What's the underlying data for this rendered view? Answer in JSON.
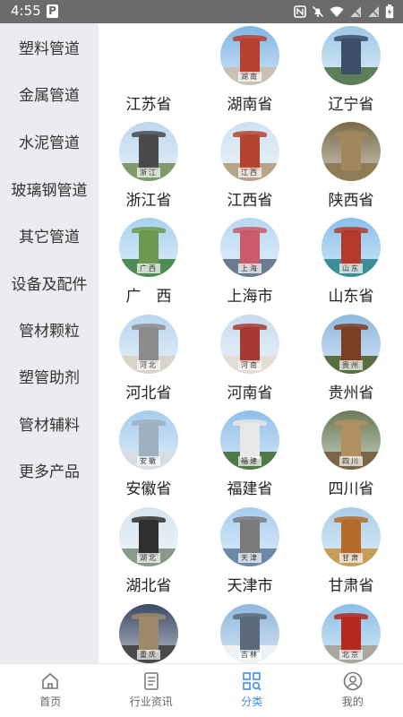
{
  "status_bar": {
    "time": "4:55",
    "icons": [
      "p-icon",
      "nfc-icon",
      "mute-icon",
      "wifi-icon",
      "signal-icon",
      "signal-icon",
      "battery-icon"
    ]
  },
  "sidebar": {
    "items": [
      {
        "label": "塑料管道"
      },
      {
        "label": "金属管道"
      },
      {
        "label": "水泥管道"
      },
      {
        "label": "玻璃钢管道"
      },
      {
        "label": "其它管道"
      },
      {
        "label": "设备及配件"
      },
      {
        "label": "管材颗粒"
      },
      {
        "label": "塑管助剂"
      },
      {
        "label": "管材辅料"
      },
      {
        "label": "更多产品"
      }
    ]
  },
  "provinces": [
    {
      "label": "江苏省",
      "tag": "",
      "image": false,
      "sky": "#ffffff",
      "ground": "#ffffff",
      "building": "#ffffff"
    },
    {
      "label": "湖南省",
      "tag": "湖南",
      "image": true,
      "sky": "#7fb6e6",
      "ground": "#c9c2b4",
      "building": "#b8402f"
    },
    {
      "label": "辽宁省",
      "tag": "",
      "image": true,
      "sky": "#9ec8e8",
      "ground": "#5e7d5a",
      "building": "#3c4f66"
    },
    {
      "label": "浙江省",
      "tag": "浙江",
      "image": true,
      "sky": "#bcd7ee",
      "ground": "#7f9a6a",
      "building": "#4a4a4a"
    },
    {
      "label": "江西省",
      "tag": "江西",
      "image": true,
      "sky": "#cfe2f2",
      "ground": "#b6a48a",
      "building": "#b5442e"
    },
    {
      "label": "陕西省",
      "tag": "",
      "image": true,
      "sky": "#7a6a4a",
      "ground": "#8f7b55",
      "building": "#a08a5c"
    },
    {
      "label": "广　西",
      "tag": "广西",
      "image": true,
      "sky": "#a8d1ee",
      "ground": "#4f8b57",
      "building": "#6b9a4e"
    },
    {
      "label": "上海市",
      "tag": "上海",
      "image": true,
      "sky": "#b7d7f3",
      "ground": "#6b7c90",
      "building": "#c95a6a"
    },
    {
      "label": "山东省",
      "tag": "山东",
      "image": true,
      "sky": "#86c0ea",
      "ground": "#3d8f97",
      "building": "#b33a2b"
    },
    {
      "label": "河北省",
      "tag": "河北",
      "image": true,
      "sky": "#b9d6ee",
      "ground": "#d9d4c9",
      "building": "#8c8c8c"
    },
    {
      "label": "河南省",
      "tag": "河南",
      "image": true,
      "sky": "#c7dcef",
      "ground": "#e4ddd3",
      "building": "#a63a33"
    },
    {
      "label": "贵州省",
      "tag": "贵州",
      "image": true,
      "sky": "#8db8df",
      "ground": "#58703f",
      "building": "#7a3e22"
    },
    {
      "label": "安徽省",
      "tag": "安徽",
      "image": true,
      "sky": "#a6cdee",
      "ground": "#d8dde3",
      "building": "#9fb0c0"
    },
    {
      "label": "福建省",
      "tag": "福建",
      "image": true,
      "sky": "#8fbfe9",
      "ground": "#4f7a45",
      "building": "#e8e8e8"
    },
    {
      "label": "四川省",
      "tag": "四川",
      "image": true,
      "sky": "#6a7a55",
      "ground": "#7c6548",
      "building": "#b08f63"
    },
    {
      "label": "湖北省",
      "tag": "湖北",
      "image": true,
      "sky": "#d6e4ef",
      "ground": "#8a9a8a",
      "building": "#2f2f2f"
    },
    {
      "label": "天津市",
      "tag": "天津",
      "image": true,
      "sky": "#a8cdef",
      "ground": "#6c8aa8",
      "building": "#7a7a7a"
    },
    {
      "label": "甘肃省",
      "tag": "甘肃",
      "image": true,
      "sky": "#a9cdea",
      "ground": "#c79d5a",
      "building": "#b46a2a"
    },
    {
      "label": "",
      "tag": "重庆",
      "image": true,
      "sky": "#3b4a66",
      "ground": "#4a4a4a",
      "building": "#9c8a6a"
    },
    {
      "label": "",
      "tag": "吉林",
      "image": true,
      "sky": "#8fb8dd",
      "ground": "#eef2f5",
      "building": "#5b6b7b"
    },
    {
      "label": "",
      "tag": "北京",
      "image": true,
      "sky": "#8cbfe8",
      "ground": "#a8a8a0",
      "building": "#b3281f"
    }
  ],
  "bottom_nav": {
    "items": [
      {
        "label": "首页",
        "icon": "home-icon",
        "active": false
      },
      {
        "label": "行业资讯",
        "icon": "news-icon",
        "active": false
      },
      {
        "label": "分类",
        "icon": "category-icon",
        "active": true
      },
      {
        "label": "我的",
        "icon": "profile-icon",
        "active": false
      }
    ],
    "active_color": "#3f8fe0",
    "inactive_color": "#666666"
  }
}
